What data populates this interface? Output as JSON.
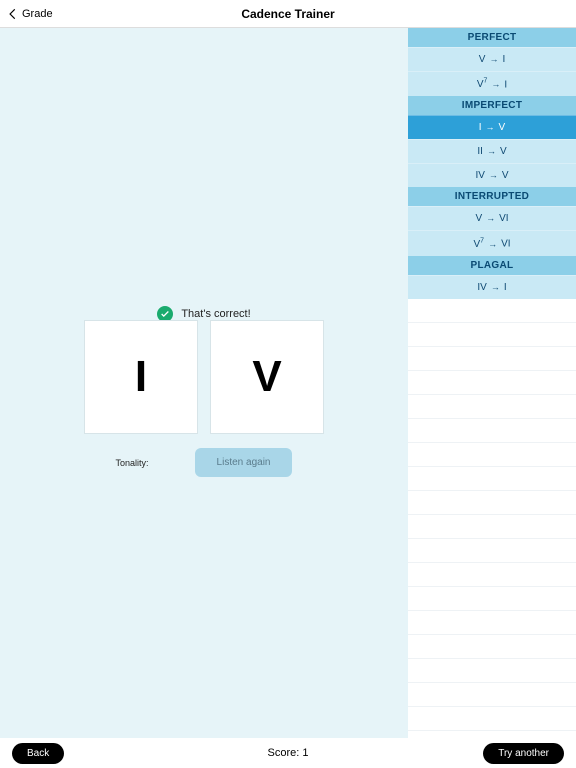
{
  "header": {
    "back_label": "Grade",
    "title": "Cadence Trainer"
  },
  "sidebar": {
    "categories": [
      {
        "name": "PERFECT",
        "items": [
          {
            "from": "V",
            "sup": "",
            "to": "I",
            "selected": false
          },
          {
            "from": "V",
            "sup": "7",
            "to": "I",
            "selected": false
          }
        ]
      },
      {
        "name": "IMPERFECT",
        "items": [
          {
            "from": "I",
            "sup": "",
            "to": "V",
            "selected": true
          },
          {
            "from": "II",
            "sup": "",
            "to": "V",
            "selected": false
          },
          {
            "from": "IV",
            "sup": "",
            "to": "V",
            "selected": false
          }
        ]
      },
      {
        "name": "INTERRUPTED",
        "items": [
          {
            "from": "V",
            "sup": "",
            "to": "VI",
            "selected": false
          },
          {
            "from": "V",
            "sup": "7",
            "to": "VI",
            "selected": false
          }
        ]
      },
      {
        "name": "PLAGAL",
        "items": [
          {
            "from": "IV",
            "sup": "",
            "to": "I",
            "selected": false
          }
        ]
      }
    ]
  },
  "feedback": {
    "text": "That's correct!"
  },
  "cards": {
    "first": "I",
    "second": "V"
  },
  "controls": {
    "tonality_label": "Tonality:",
    "listen_label": "Listen again"
  },
  "footer": {
    "back_label": "Back",
    "score_label": "Score: 1",
    "try_label": "Try another"
  }
}
